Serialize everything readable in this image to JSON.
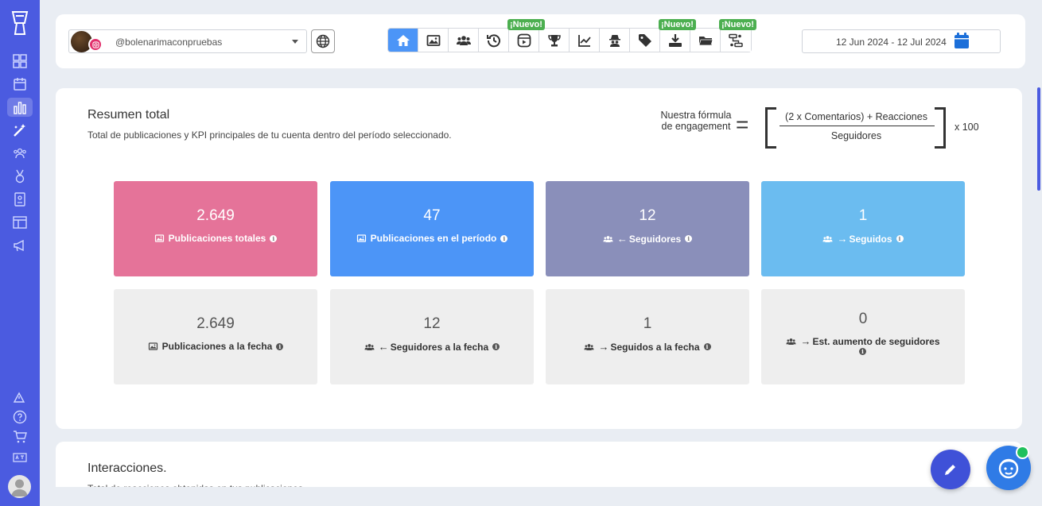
{
  "account": {
    "handle": "@bolenarimaconpruebas"
  },
  "nav_tabs": [
    {
      "icon": "home-icon",
      "active": true,
      "badge": ""
    },
    {
      "icon": "image-icon",
      "active": false,
      "badge": ""
    },
    {
      "icon": "users-icon",
      "active": false,
      "badge": ""
    },
    {
      "icon": "history-icon",
      "active": false,
      "badge": ""
    },
    {
      "icon": "reels-icon",
      "active": false,
      "badge": "¡Nuevo!"
    },
    {
      "icon": "trophy-icon",
      "active": false,
      "badge": ""
    },
    {
      "icon": "chart-line-icon",
      "active": false,
      "badge": ""
    },
    {
      "icon": "spy-icon",
      "active": false,
      "badge": ""
    },
    {
      "icon": "tag-icon",
      "active": false,
      "badge": ""
    },
    {
      "icon": "download-icon",
      "active": false,
      "badge": "¡Nuevo!"
    },
    {
      "icon": "folder-icon",
      "active": false,
      "badge": ""
    },
    {
      "icon": "flow-icon",
      "active": false,
      "badge": "¡Nuevo!"
    }
  ],
  "date_range": "12 Jun 2024 - 12 Jul 2024",
  "summary": {
    "title": "Resumen total",
    "subtitle": "Total de publicaciones y KPI principales de tu cuenta dentro del período seleccionado."
  },
  "formula": {
    "label": "Nuestra fórmula de engagement",
    "numerator": "(2 x Comentarios) + Reacciones",
    "denominator": "Seguidores",
    "multiplier": "x 100"
  },
  "kpis_top": [
    {
      "value": "2.649",
      "label": "Publicaciones totales",
      "icon": "image-icon",
      "arrow": "",
      "color": "#e57399"
    },
    {
      "value": "47",
      "label": "Publicaciones en el período",
      "icon": "image-icon",
      "arrow": "",
      "color": "#4c95f7"
    },
    {
      "value": "12",
      "label": "Seguidores",
      "icon": "users-icon",
      "arrow": "←",
      "color": "#8a8fba"
    },
    {
      "value": "1",
      "label": "Seguidos",
      "icon": "users-icon",
      "arrow": "→",
      "color": "#6bbcf0"
    }
  ],
  "kpis_bottom": [
    {
      "value": "2.649",
      "label": "Publicaciones a la fecha",
      "icon": "image-icon",
      "arrow": ""
    },
    {
      "value": "12",
      "label": "Seguidores a la fecha",
      "icon": "users-icon",
      "arrow": "←"
    },
    {
      "value": "1",
      "label": "Seguidos a la fecha",
      "icon": "users-icon",
      "arrow": "→"
    },
    {
      "value": "0",
      "label": "Est. aumento de seguidores",
      "icon": "users-icon",
      "arrow": "→"
    }
  ],
  "interactions": {
    "title": "Interacciones.",
    "subtitle": "Total de reacciones obtenidas en tus publicaciones."
  }
}
